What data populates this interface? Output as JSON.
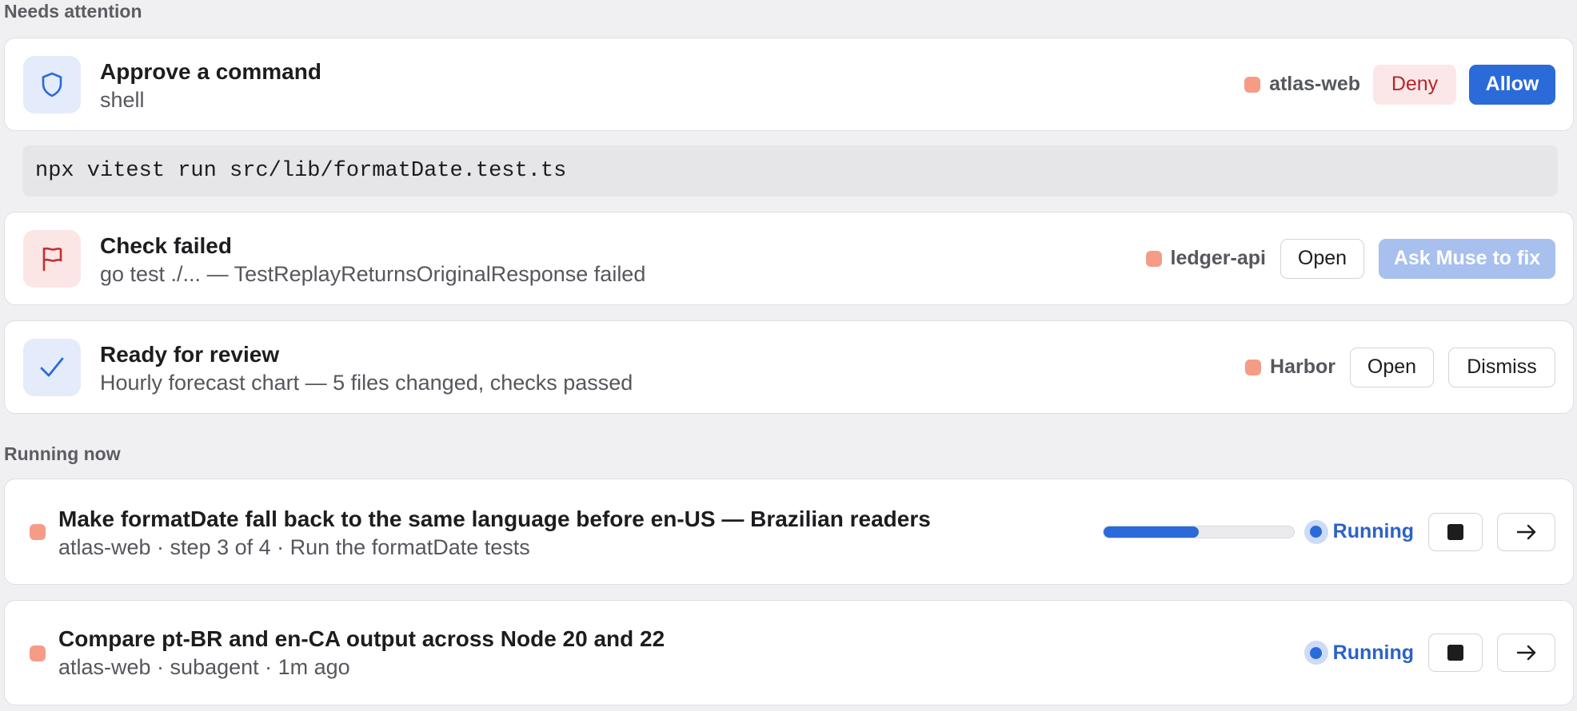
{
  "needs_attention": {
    "heading": "Needs attention",
    "approve_card": {
      "title": "Approve a command",
      "subtitle": "shell",
      "icon": "shield-icon",
      "project": "atlas-web",
      "deny_label": "Deny",
      "allow_label": "Allow",
      "command": "npx vitest run src/lib/formatDate.test.ts"
    },
    "check_failed_card": {
      "title": "Check failed",
      "subtitle": "go test ./... — TestReplayReturnsOriginalResponse failed",
      "icon": "flag-icon",
      "project": "ledger-api",
      "open_label": "Open",
      "fix_label": "Ask Muse to fix"
    },
    "review_card": {
      "title": "Ready for review",
      "subtitle": "Hourly forecast chart — 5 files changed, checks passed",
      "icon": "check-icon",
      "project": "Harbor",
      "open_label": "Open",
      "dismiss_label": "Dismiss"
    }
  },
  "running_now": {
    "heading": "Running now",
    "tasks": [
      {
        "title": "Make formatDate fall back to the same language before en-US — Brazilian readers",
        "subtitle": "atlas-web · step 3 of 4 · Run the formatDate tests",
        "progress": 0.5,
        "status": "Running"
      },
      {
        "title": "Compare pt-BR and en-CA output across Node 20 and 22",
        "subtitle": "atlas-web · subagent · 1m ago",
        "status": "Running"
      }
    ]
  },
  "colors": {
    "accent": "#2b6ad9",
    "project_dot": "#f59b86",
    "deny_text": "#b4262a",
    "check_failed_tile": "#fbe5e5",
    "info_tile": "#e4ebfb"
  }
}
